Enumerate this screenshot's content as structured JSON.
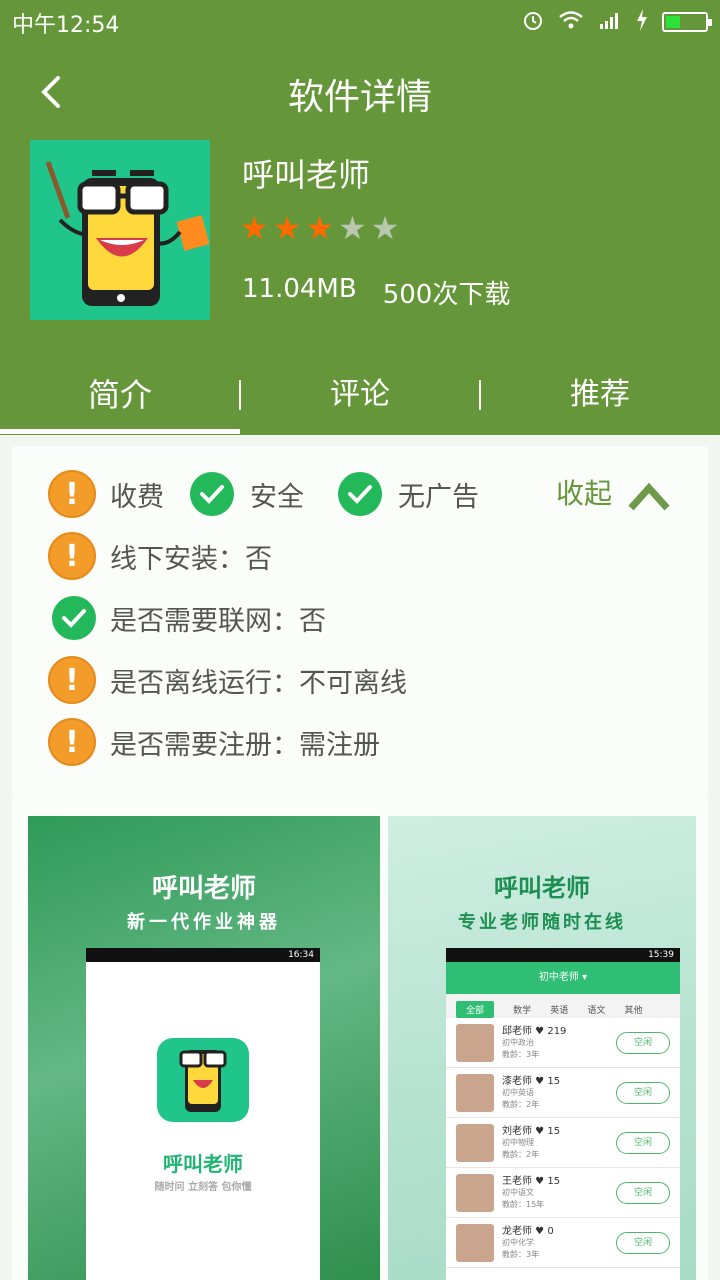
{
  "status": {
    "time": "中午12:54"
  },
  "header": {
    "title": "软件详情",
    "app_name": "呼叫老师",
    "rating": 3,
    "size": "11.04MB",
    "downloads": "500次下载"
  },
  "tabs": [
    {
      "label": "简介",
      "active": true
    },
    {
      "label": "评论",
      "active": false
    },
    {
      "label": "推荐",
      "active": false
    }
  ],
  "info": {
    "tags": [
      {
        "label": "收费",
        "status": "warn"
      },
      {
        "label": "安全",
        "status": "ok"
      },
      {
        "label": "无广告",
        "status": "ok"
      }
    ],
    "collapse_label": "收起",
    "details": [
      {
        "text": "线下安装：否",
        "status": "warn"
      },
      {
        "text": "是否需要联网：否",
        "status": "ok"
      },
      {
        "text": "是否离线运行：不可离线",
        "status": "warn"
      },
      {
        "text": "是否需要注册：需注册",
        "status": "warn"
      }
    ]
  },
  "screenshot1": {
    "title": "呼叫老师",
    "subtitle": "新一代作业神器",
    "phone_time": "16:34",
    "app_label": "呼叫老师",
    "slogan": "随时问 立刻答 包你懂"
  },
  "screenshot2": {
    "title": "呼叫老师",
    "subtitle": "专业老师随时在线",
    "phone_time": "15:39",
    "topbar": "初中老师 ▾",
    "categories": [
      "全部",
      "数学",
      "英语",
      "语文",
      "其他"
    ],
    "button_label": "空闲",
    "teachers": [
      {
        "name": "邱老师",
        "likes": "219",
        "subject": "初中政治",
        "age": "教龄：3年"
      },
      {
        "name": "漆老师",
        "likes": "15",
        "subject": "初中英语",
        "age": "教龄：2年"
      },
      {
        "name": "刘老师",
        "likes": "15",
        "subject": "初中物理",
        "age": "教龄：2年"
      },
      {
        "name": "王老师",
        "likes": "15",
        "subject": "初中语文",
        "age": "教龄：15年"
      },
      {
        "name": "龙老师",
        "likes": "0",
        "subject": "初中化学",
        "age": "教龄：3年"
      }
    ]
  },
  "colors": {
    "brand": "#65973a",
    "warn": "#f39c2a",
    "ok": "#23b95a",
    "star_on": "#ff6a00",
    "star_off": "#b9c7ae"
  }
}
